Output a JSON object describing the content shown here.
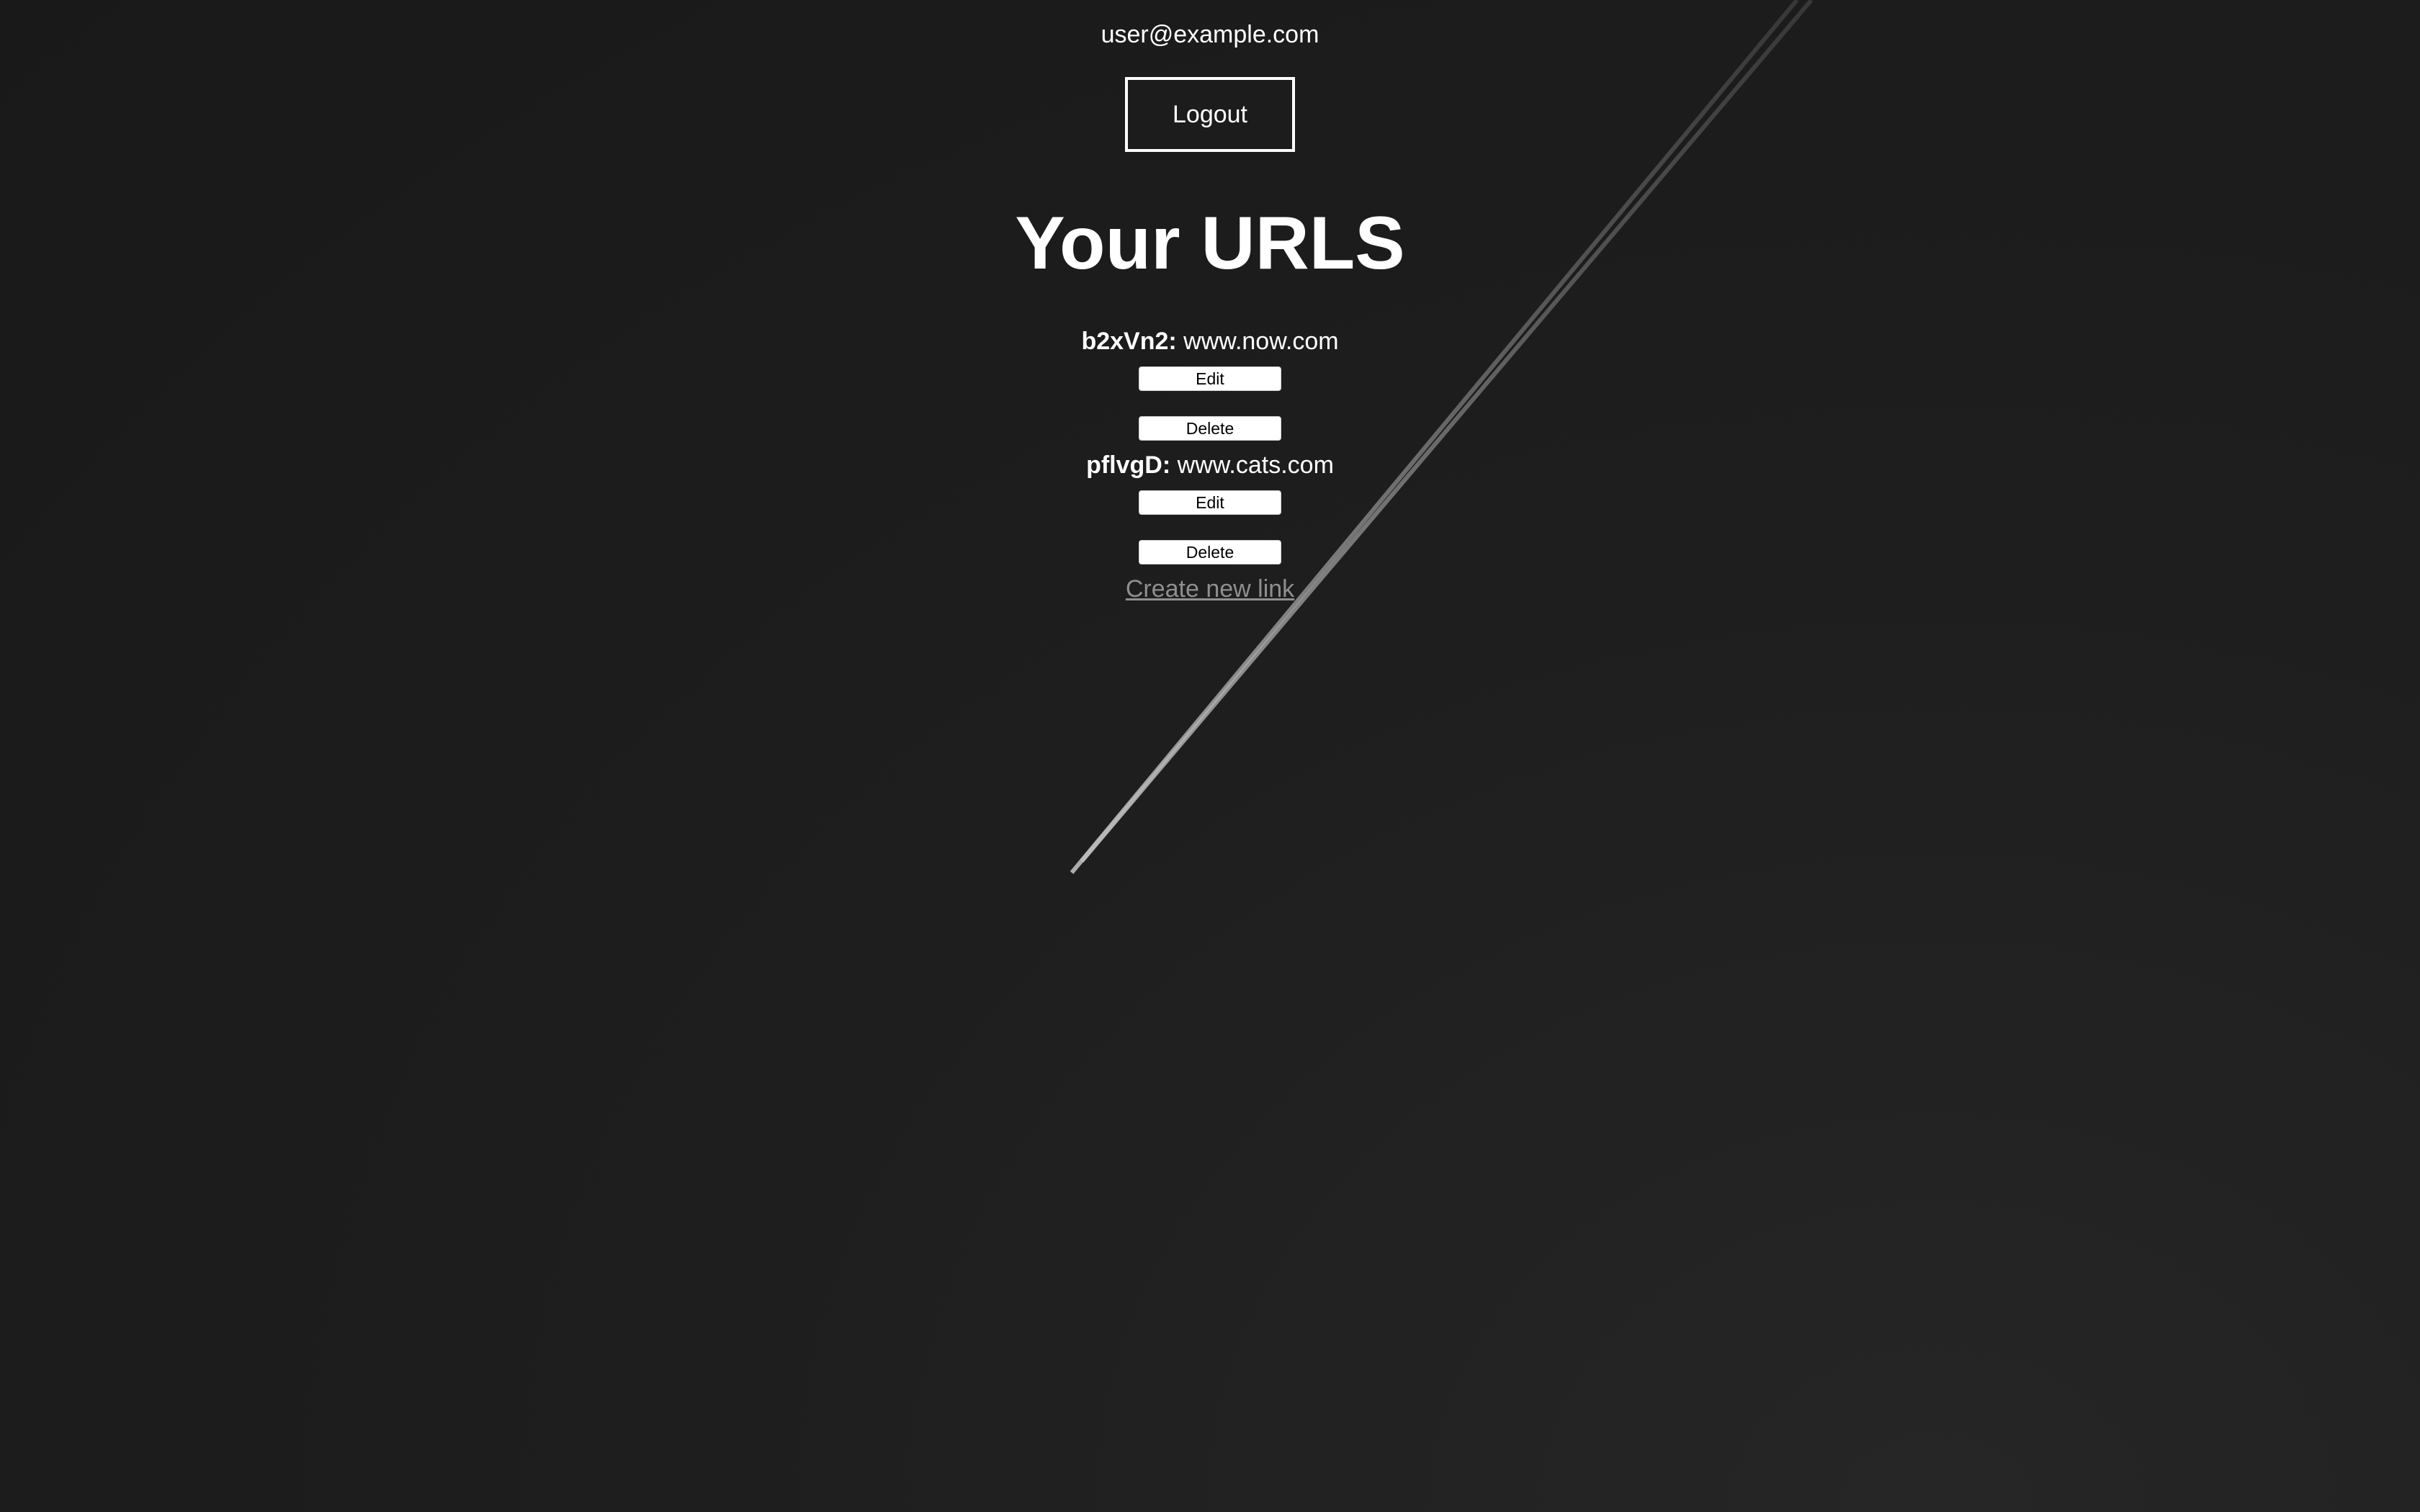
{
  "header": {
    "user_email": "user@example.com",
    "logout_label": "Logout"
  },
  "main": {
    "title": "Your URLS",
    "urls": [
      {
        "short_id": "b2xVn2:",
        "long_url": "www.now.com",
        "edit_label": "Edit",
        "delete_label": "Delete"
      },
      {
        "short_id": "pflvgD:",
        "long_url": "www.cats.com",
        "edit_label": "Edit",
        "delete_label": "Delete"
      }
    ],
    "create_link_label": "Create new link"
  },
  "colors": {
    "background": "#1c1c1c",
    "text": "#ffffff",
    "link": "#8f8f8f",
    "button_background": "#ffffff"
  }
}
